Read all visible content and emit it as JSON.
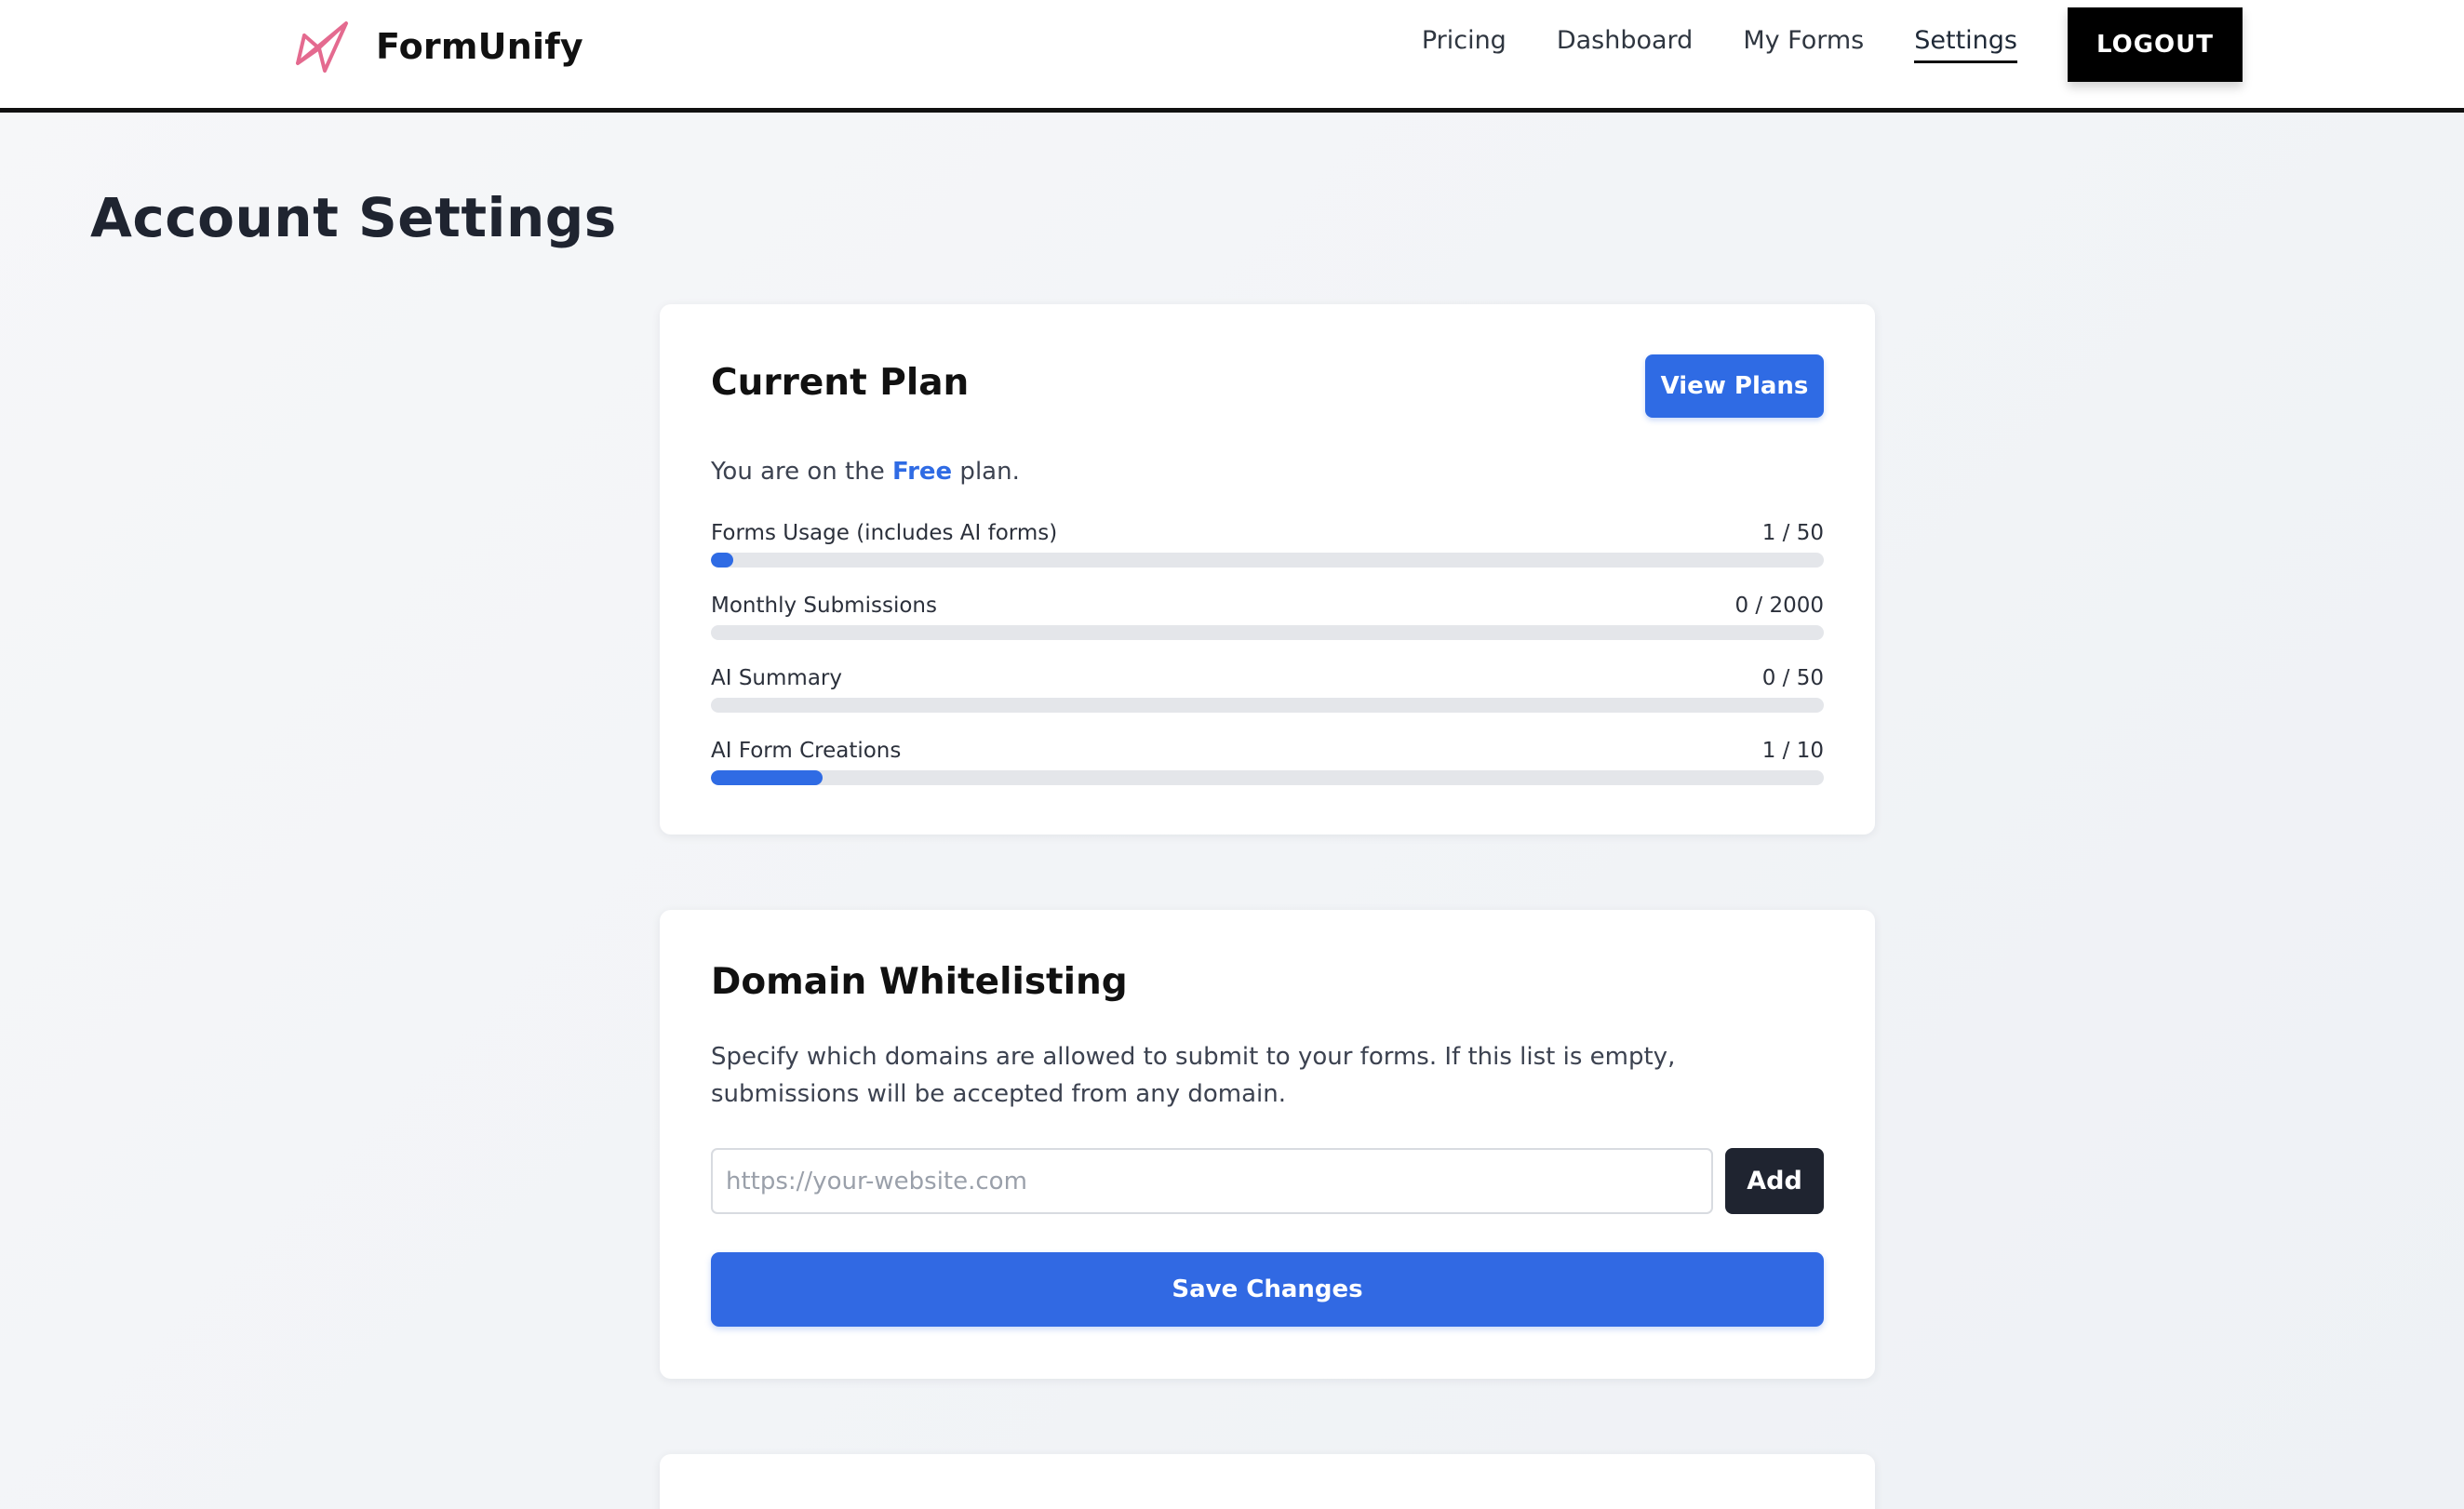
{
  "header": {
    "brand": "FormUnify",
    "logo_icon": "paper-plane-icon",
    "nav": [
      {
        "label": "Pricing",
        "active": false
      },
      {
        "label": "Dashboard",
        "active": false
      },
      {
        "label": "My Forms",
        "active": false
      },
      {
        "label": "Settings",
        "active": true
      }
    ],
    "logout_label": "LOGOUT"
  },
  "page": {
    "title": "Account Settings"
  },
  "current_plan": {
    "title": "Current Plan",
    "view_plans_label": "View Plans",
    "text_before": "You are on the ",
    "plan_name": "Free",
    "text_after": " plan.",
    "usage": [
      {
        "label": "Forms Usage (includes AI forms)",
        "used": 1,
        "limit": 50,
        "count_text": "1 / 50"
      },
      {
        "label": "Monthly Submissions",
        "used": 0,
        "limit": 2000,
        "count_text": "0 / 2000"
      },
      {
        "label": "AI Summary",
        "used": 0,
        "limit": 50,
        "count_text": "0 / 50"
      },
      {
        "label": "AI Form Creations",
        "used": 1,
        "limit": 10,
        "count_text": "1 / 10"
      }
    ]
  },
  "domain_whitelisting": {
    "title": "Domain Whitelisting",
    "description": "Specify which domains are allowed to submit to your forms. If this list is empty, submissions will be accepted from any domain.",
    "input_value": "",
    "input_placeholder": "https://your-website.com",
    "add_label": "Add",
    "save_label": "Save Changes"
  },
  "colors": {
    "accent": "#2f6be4",
    "header_border": "#111111",
    "logo": "#e46a8f",
    "dark_button": "#1f2430"
  }
}
